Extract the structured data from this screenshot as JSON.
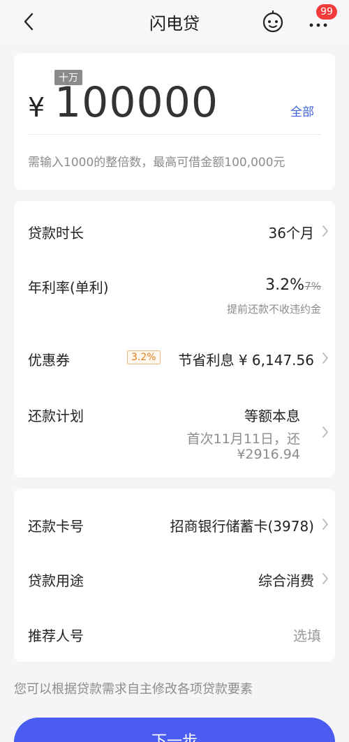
{
  "nav": {
    "title": "闪电贷",
    "badge": "99"
  },
  "amount": {
    "unit_tag": "十万",
    "currency": "¥",
    "value": "100000",
    "all_label": "全部",
    "hint": "需输入1000的整倍数，最高可借金额100,000元"
  },
  "loan": {
    "term_label": "贷款时长",
    "term_value": "36个月",
    "rate_label": "年利率(单利)",
    "rate_value": "3.2%",
    "rate_old": "7%",
    "rate_note": "提前还款不收违约金",
    "coupon_label": "优惠券",
    "coupon_tag": "3.2%",
    "coupon_value": "节省利息 ¥ 6,147.56",
    "plan_label": "还款计划",
    "plan_value": "等额本息",
    "plan_first": "首次11月11日，还",
    "plan_amount": "¥2916.94"
  },
  "extra": {
    "card_label": "还款卡号",
    "card_value": "招商银行储蓄卡(3978)",
    "purpose_label": "贷款用途",
    "purpose_value": "综合消费",
    "referrer_label": "推荐人号",
    "referrer_placeholder": "选填"
  },
  "footer": {
    "hint": "您可以根据贷款需求自主修改各项贷款要素",
    "next_label": "下一步"
  }
}
